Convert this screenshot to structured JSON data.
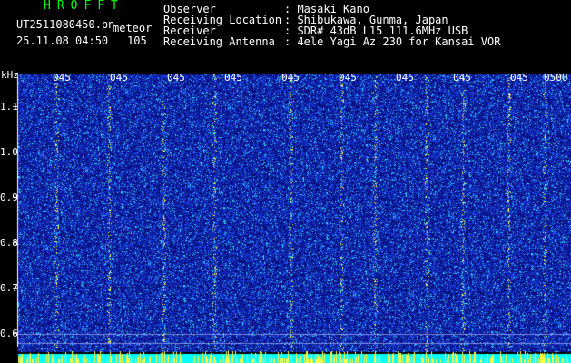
{
  "header": {
    "app_title": "HROFFT",
    "file_name": "UT2511080450.pn",
    "meteor_label": "meteor",
    "date_time": "25.11.08 04:50",
    "count": "105",
    "info": [
      {
        "label": "Observer",
        "value": ": Masaki Kano"
      },
      {
        "label": "Receiving Location",
        "value": ": Shibukawa, Gunma, Japan"
      },
      {
        "label": "Receiver",
        "value": ": SDR# 43dB L15 111.6MHz USB"
      },
      {
        "label": "Receiving Antenna",
        "value": ": 4ele Yagi Az 230 for Kansai VOR"
      }
    ]
  },
  "spectrogram": {
    "y_unit": "kHz",
    "y_ticks": [
      {
        "label": "1.1",
        "value": 1.1
      },
      {
        "label": "1.0",
        "value": 1.0
      },
      {
        "label": "0.9",
        "value": 0.9
      },
      {
        "label": "0.8",
        "value": 0.8
      },
      {
        "label": "0.7",
        "value": 0.7
      },
      {
        "label": "0.6",
        "value": 0.6
      }
    ],
    "y_range": [
      0.57,
      1.17
    ],
    "x_ticks": [
      "045",
      "045",
      "045",
      "045",
      "045",
      "045",
      "045",
      "045",
      "045",
      "0500"
    ],
    "colors": {
      "background": "#000000",
      "low": "#0a0a8a",
      "mid": "#1e46ff",
      "high": "#30d8ff",
      "peak": "#ffff40",
      "baseline": "#00ffff"
    }
  }
}
